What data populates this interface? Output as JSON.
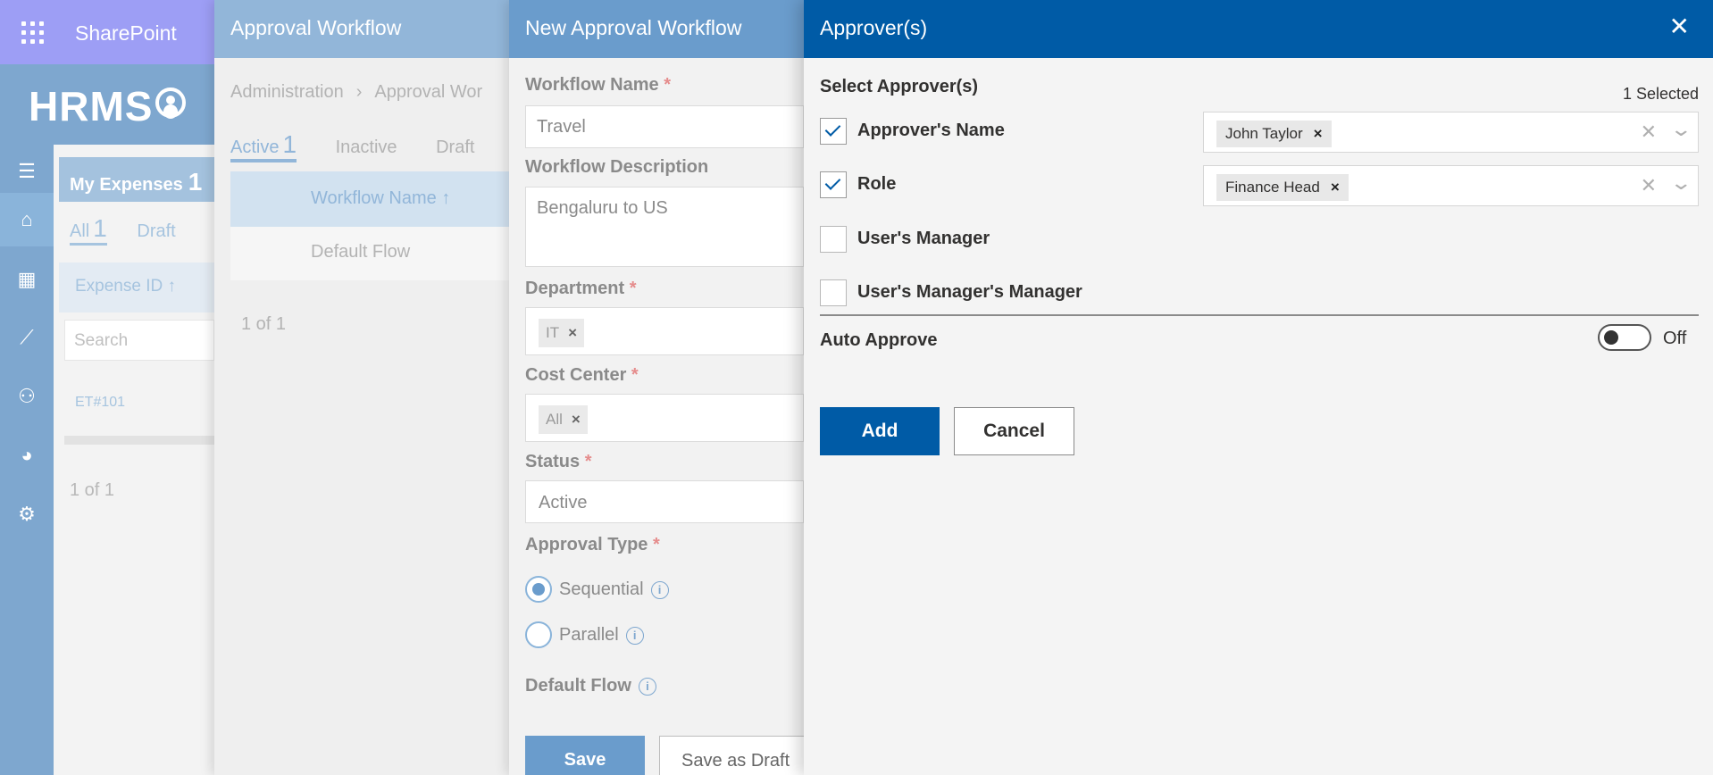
{
  "suitebar": {
    "app_name": "SharePoint",
    "waffle_icon": "waffle-icon"
  },
  "brand": {
    "logo_text": "HRMS",
    "logo_badge_icon": "user-circle-icon"
  },
  "left_rail": {
    "items": [
      {
        "icon": "hamburger-menu-icon",
        "glyph": "☰"
      },
      {
        "icon": "home-icon",
        "glyph": "⌂"
      },
      {
        "icon": "bar-chart-icon",
        "glyph": "▦"
      },
      {
        "icon": "line-chart-icon",
        "glyph": "⟋"
      },
      {
        "icon": "user-settings-icon",
        "glyph": "⚇"
      },
      {
        "icon": "palette-icon",
        "glyph": "◕"
      },
      {
        "icon": "gear-icon",
        "glyph": "⚙"
      }
    ]
  },
  "my_expenses": {
    "title": "My Expenses",
    "count": "1",
    "tabs": {
      "all_label": "All",
      "all_count": "1",
      "draft_label": "Draft"
    },
    "column_header": "Expense ID ↑",
    "search_placeholder": "Search",
    "rows": [
      "ET#101"
    ],
    "pager": "1 of 1"
  },
  "approval_workflow": {
    "title": "Approval Workflow",
    "breadcrumb": [
      "Administration",
      "Approval Wor"
    ],
    "breadcrumb_sep": "›",
    "tabs": {
      "active_label": "Active",
      "active_count": "1",
      "inactive_label": "Inactive",
      "draft_label": "Draft"
    },
    "column_header": "Workflow Name ↑",
    "rows": [
      "Default Flow"
    ],
    "pager": "1 of 1"
  },
  "new_approval_workflow": {
    "title": "New Approval Workflow",
    "required_marker": "*",
    "workflow_name_label": "Workflow Name",
    "workflow_name_value": "Travel",
    "workflow_description_label": "Workflow Description",
    "workflow_description_value": "Bengaluru to US",
    "department_label": "Department",
    "department_tag": "IT",
    "cost_center_label": "Cost Center",
    "cost_center_tag": "All",
    "status_label": "Status",
    "status_value": "Active",
    "approval_type_label": "Approval Type",
    "approval_type_options": [
      "Sequential",
      "Parallel"
    ],
    "approval_type_selected": "Sequential",
    "default_flow_label": "Default Flow",
    "info_glyph": "i",
    "save_label": "Save",
    "save_draft_label": "Save as Draft"
  },
  "approvers_panel": {
    "title": "Approver(s)",
    "close_glyph": "✕",
    "section_title": "Select Approver(s)",
    "selected_count": "1 Selected",
    "tag_remove_glyph": "×",
    "clear_glyph": "✕",
    "chevron_glyph": "⌄",
    "rows": [
      {
        "label": "Approver's Name",
        "checked": true,
        "picker_tag": "John Taylor"
      },
      {
        "label": "Role",
        "checked": true,
        "picker_tag": "Finance Head"
      },
      {
        "label": "User's Manager",
        "checked": false
      },
      {
        "label": "User's Manager's Manager",
        "checked": false
      }
    ],
    "auto_approve_label": "Auto Approve",
    "auto_approve_state": "Off",
    "add_label": "Add",
    "cancel_label": "Cancel",
    "accent_color": "#005ba6"
  }
}
